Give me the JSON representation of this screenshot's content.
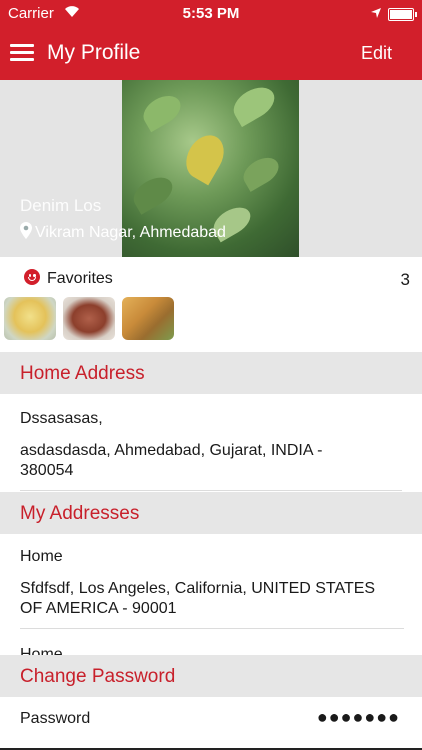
{
  "status_bar": {
    "carrier": "Carrier",
    "time": "5:53 PM"
  },
  "nav": {
    "title": "My Profile",
    "edit_label": "Edit"
  },
  "profile": {
    "name": "Denim Los",
    "location": "Vikram Nagar, Ahmedabad"
  },
  "favorites": {
    "label": "Favorites",
    "count": "3"
  },
  "home_address": {
    "header": "Home Address",
    "name": "Dssasasas,",
    "address_line1": "asdasdasda, Ahmedabad, Gujarat, INDIA -",
    "address_line2": "380054"
  },
  "my_addresses": {
    "header": "My Addresses",
    "items": [
      {
        "label": "Home",
        "line1": "Sfdfsdf, Los Angeles, California, UNITED STATES",
        "line2": "OF AMERICA  - 90001"
      },
      {
        "label": "Home"
      }
    ]
  },
  "change_password": {
    "header": "Change Password",
    "label": "Password",
    "masked_value": "●●●●●●●"
  },
  "colors": {
    "accent": "#d21f2b",
    "section_bg": "#e6e6e6",
    "section_text": "#c8202b"
  },
  "icons": [
    "hamburger-icon",
    "pin-icon",
    "smiley-icon",
    "wifi-icon",
    "location-arrow-icon",
    "battery-icon"
  ]
}
